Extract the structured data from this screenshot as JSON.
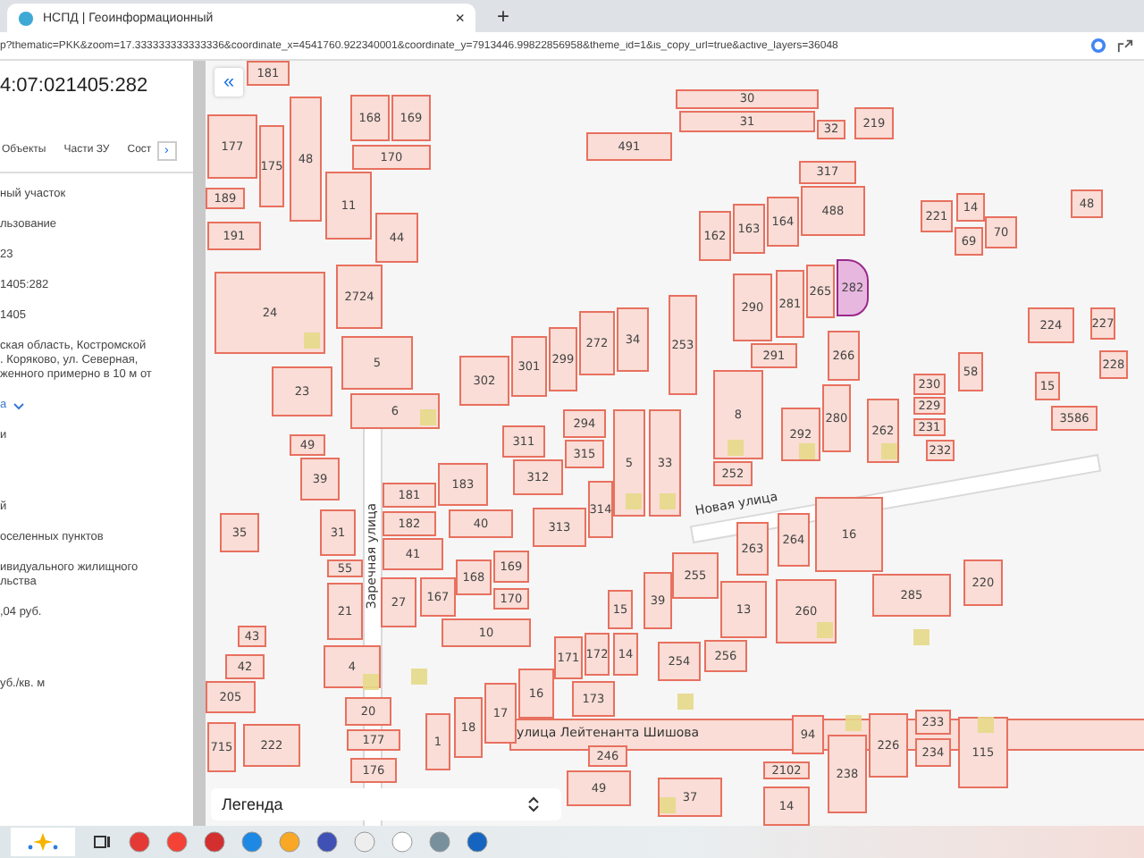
{
  "browser": {
    "tab_title": "НСПД | Геоинформационный",
    "tab_close": "×",
    "new_tab": "+",
    "url": "p?thematic=PKK&zoom=17.333333333333336&coordinate_x=4541760.922340001&coordinate_y=7913446.99822856958&theme_id=1&is_copy_url=true&active_layers=36048"
  },
  "panel": {
    "title": "4:07:021405:282",
    "tabs": [
      {
        "label": "Объекты",
        "selected": false
      },
      {
        "label": "Части ЗУ",
        "selected": false
      },
      {
        "label": "Сост",
        "selected": false
      }
    ],
    "tab_scroll": "›",
    "rows": [
      {
        "kind": "text",
        "lines": [
          "ный участок"
        ]
      },
      {
        "kind": "text",
        "lines": [
          "льзование"
        ]
      },
      {
        "kind": "text",
        "lines": [
          "23"
        ]
      },
      {
        "kind": "text",
        "lines": [
          "1405:282"
        ]
      },
      {
        "kind": "text",
        "lines": [
          "1405"
        ]
      },
      {
        "kind": "text",
        "lines": [
          "ская область, Костромской",
          ". Коряково, ул. Северная,",
          "женного примерно в 10 м от"
        ]
      },
      {
        "kind": "link",
        "lines": [
          "а"
        ]
      },
      {
        "kind": "text",
        "lines": [
          "и"
        ]
      },
      {
        "kind": "gap",
        "lines": []
      },
      {
        "kind": "text",
        "lines": [
          "й"
        ]
      },
      {
        "kind": "text",
        "lines": [
          "оселенных пунктов"
        ]
      },
      {
        "kind": "text",
        "lines": [
          "ивидуального жилищного",
          "льства"
        ]
      },
      {
        "kind": "text",
        "lines": [
          ",04 руб."
        ]
      },
      {
        "kind": "gap",
        "lines": []
      },
      {
        "kind": "text",
        "lines": [
          "уб./кв. м"
        ]
      }
    ]
  },
  "map": {
    "collapse": "«",
    "legend": "Легенда",
    "parcels": [
      {
        "label": "181",
        "selected": false
      },
      {
        "label": "168",
        "selected": false
      },
      {
        "label": "169",
        "selected": false
      },
      {
        "label": "30",
        "selected": false
      },
      {
        "label": "31",
        "selected": false
      },
      {
        "label": "32",
        "selected": false
      },
      {
        "label": "219",
        "selected": false
      },
      {
        "label": "177",
        "selected": false
      },
      {
        "label": "175",
        "selected": false
      },
      {
        "label": "48",
        "selected": false
      },
      {
        "label": "170",
        "selected": false
      },
      {
        "label": "491",
        "selected": false
      },
      {
        "label": "317",
        "selected": false
      },
      {
        "label": "189",
        "selected": false
      },
      {
        "label": "11",
        "selected": false
      },
      {
        "label": "164",
        "selected": false
      },
      {
        "label": "488",
        "selected": false
      },
      {
        "label": "221",
        "selected": false
      },
      {
        "label": "14",
        "selected": false
      },
      {
        "label": "48",
        "selected": false
      },
      {
        "label": "191",
        "selected": false
      },
      {
        "label": "44",
        "selected": false
      },
      {
        "label": "162",
        "selected": false
      },
      {
        "label": "163",
        "selected": false
      },
      {
        "label": "69",
        "selected": false
      },
      {
        "label": "70",
        "selected": false
      },
      {
        "label": "24",
        "selected": false
      },
      {
        "label": "2724",
        "selected": false
      },
      {
        "label": "290",
        "selected": false
      },
      {
        "label": "281",
        "selected": false
      },
      {
        "label": "265",
        "selected": false
      },
      {
        "label": "282",
        "selected": true
      },
      {
        "label": "272",
        "selected": false
      },
      {
        "label": "34",
        "selected": false
      },
      {
        "label": "253",
        "selected": false
      },
      {
        "label": "291",
        "selected": false
      },
      {
        "label": "266",
        "selected": false
      },
      {
        "label": "224",
        "selected": false
      },
      {
        "label": "227",
        "selected": false
      },
      {
        "label": "23",
        "selected": false
      },
      {
        "label": "5",
        "selected": false
      },
      {
        "label": "302",
        "selected": false
      },
      {
        "label": "301",
        "selected": false
      },
      {
        "label": "299",
        "selected": false
      },
      {
        "label": "8",
        "selected": false
      },
      {
        "label": "230",
        "selected": false
      },
      {
        "label": "58",
        "selected": false
      },
      {
        "label": "15",
        "selected": false
      },
      {
        "label": "228",
        "selected": false
      },
      {
        "label": "49",
        "selected": false
      },
      {
        "label": "6",
        "selected": false
      },
      {
        "label": "311",
        "selected": false
      },
      {
        "label": "294",
        "selected": false
      },
      {
        "label": "292",
        "selected": false
      },
      {
        "label": "280",
        "selected": false
      },
      {
        "label": "262",
        "selected": false
      },
      {
        "label": "229",
        "selected": false
      },
      {
        "label": "231",
        "selected": false
      },
      {
        "label": "232",
        "selected": false
      },
      {
        "label": "3586",
        "selected": false
      },
      {
        "label": "39",
        "selected": false
      },
      {
        "label": "183",
        "selected": false
      },
      {
        "label": "312",
        "selected": false
      },
      {
        "label": "315",
        "selected": false
      },
      {
        "label": "5",
        "selected": false
      },
      {
        "label": "33",
        "selected": false
      },
      {
        "label": "252",
        "selected": false
      },
      {
        "label": "35",
        "selected": false
      },
      {
        "label": "31",
        "selected": false
      },
      {
        "label": "181",
        "selected": false
      },
      {
        "label": "182",
        "selected": false
      },
      {
        "label": "40",
        "selected": false
      },
      {
        "label": "313",
        "selected": false
      },
      {
        "label": "314",
        "selected": false
      },
      {
        "label": "16",
        "selected": false
      },
      {
        "label": "55",
        "selected": false
      },
      {
        "label": "41",
        "selected": false
      },
      {
        "label": "168",
        "selected": false
      },
      {
        "label": "169",
        "selected": false
      },
      {
        "label": "255",
        "selected": false
      },
      {
        "label": "263",
        "selected": false
      },
      {
        "label": "264",
        "selected": false
      },
      {
        "label": "21",
        "selected": false
      },
      {
        "label": "27",
        "selected": false
      },
      {
        "label": "167",
        "selected": false
      },
      {
        "label": "10",
        "selected": false
      },
      {
        "label": "170",
        "selected": false
      },
      {
        "label": "15",
        "selected": false
      },
      {
        "label": "39",
        "selected": false
      },
      {
        "label": "13",
        "selected": false
      },
      {
        "label": "260",
        "selected": false
      },
      {
        "label": "285",
        "selected": false
      },
      {
        "label": "220",
        "selected": false
      },
      {
        "label": "43",
        "selected": false
      },
      {
        "label": "42",
        "selected": false
      },
      {
        "label": "4",
        "selected": false
      },
      {
        "label": "171",
        "selected": false
      },
      {
        "label": "172",
        "selected": false
      },
      {
        "label": "14",
        "selected": false
      },
      {
        "label": "254",
        "selected": false
      },
      {
        "label": "256",
        "selected": false
      },
      {
        "label": "205",
        "selected": false
      },
      {
        "label": "20",
        "selected": false
      },
      {
        "label": "17",
        "selected": false
      },
      {
        "label": "16",
        "selected": false
      },
      {
        "label": "173",
        "selected": false
      },
      {
        "label": "715",
        "selected": false
      },
      {
        "label": "222",
        "selected": false
      },
      {
        "label": "177",
        "selected": false
      },
      {
        "label": "1",
        "selected": false
      },
      {
        "label": "18",
        "selected": false
      },
      {
        "label": "246",
        "selected": false
      },
      {
        "label": "94",
        "selected": false
      },
      {
        "label": "226",
        "selected": false
      },
      {
        "label": "233",
        "selected": false
      },
      {
        "label": "234",
        "selected": false
      },
      {
        "label": "115",
        "selected": false
      },
      {
        "label": "176",
        "selected": false
      },
      {
        "label": "49",
        "selected": false
      },
      {
        "label": "37",
        "selected": false
      },
      {
        "label": "2102",
        "selected": false
      },
      {
        "label": "14",
        "selected": false
      },
      {
        "label": "238",
        "selected": false
      }
    ],
    "streets": [
      "Заречная улица",
      "Новая улица",
      "улица Лейтенанта Шишова"
    ]
  }
}
